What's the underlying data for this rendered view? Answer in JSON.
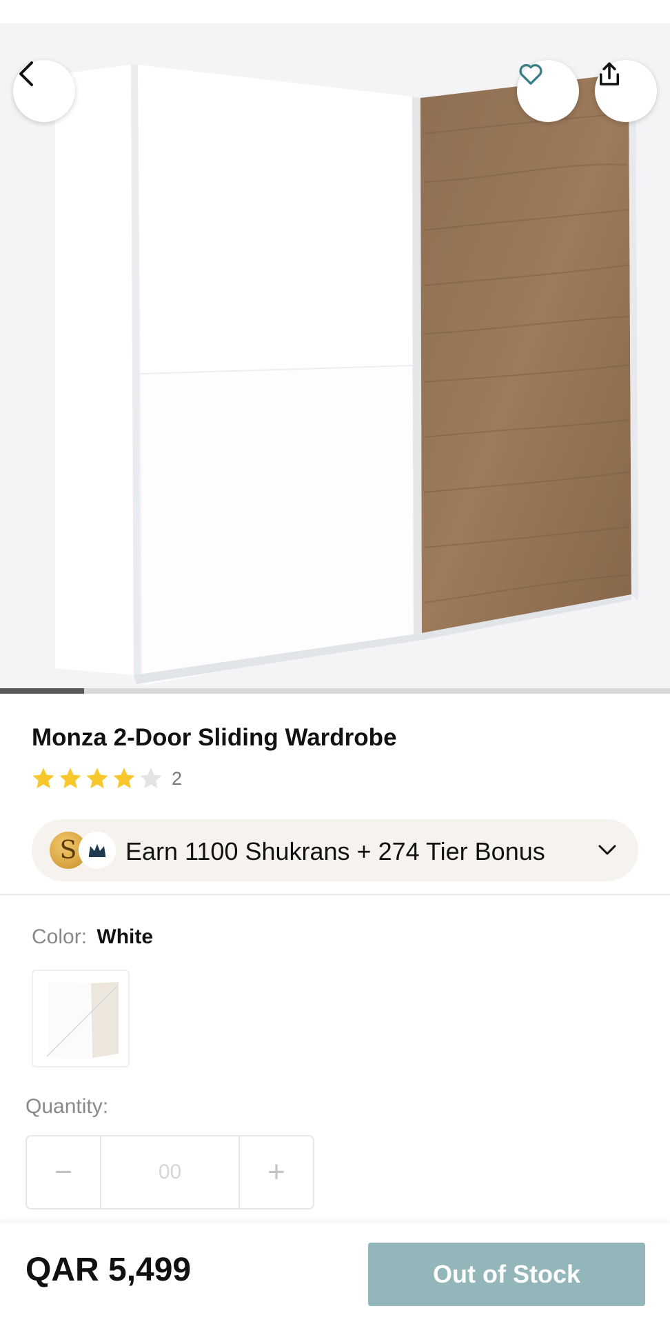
{
  "colors": {
    "accent_teal": "#3a7f86",
    "star_filled": "#f7c72c",
    "star_empty": "#e3e3e3",
    "out_of_stock_bg": "#93b6ba",
    "rewards_bg": "#f6f3ee"
  },
  "header": {
    "back_icon": "chevron-left-icon",
    "favorite_icon": "heart-icon",
    "share_icon": "share-icon"
  },
  "gallery": {
    "progress_fraction": 0.125
  },
  "product": {
    "title": "Monza 2-Door Sliding Wardrobe",
    "rating": 4,
    "rating_max": 5,
    "review_count": "2"
  },
  "rewards": {
    "coin_letter": "S",
    "text": "Earn 1100 Shukrans + 274 Tier Bonus",
    "expand_icon": "chevron-down-icon"
  },
  "color": {
    "label": "Color:",
    "value": "White"
  },
  "quantity": {
    "label": "Quantity:",
    "value": "00",
    "minus": "−",
    "plus": "+"
  },
  "footer": {
    "price": "QAR 5,499",
    "button_label": "Out of Stock"
  }
}
